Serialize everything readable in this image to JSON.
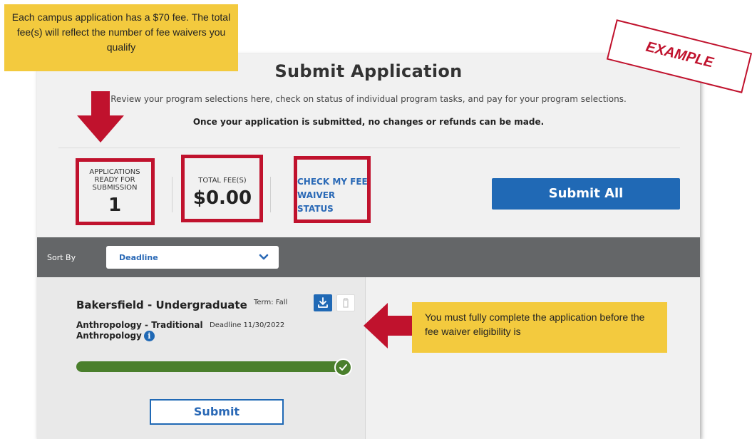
{
  "page": {
    "title": "Submit Application",
    "subtitle": "Review your program selections here, check on status of individual program tasks, and pay for your program selections.",
    "notice": "Once your application is submitted, no changes or refunds can be made."
  },
  "stats": {
    "applications_label": "APPLICATIONS READY FOR SUBMISSION",
    "applications_count": "1",
    "total_fee_label": "TOTAL FEE(S)",
    "total_fee_value": "$0.00",
    "fee_waiver_link": "CHECK MY FEE WAIVER STATUS"
  },
  "actions": {
    "submit_all_label": "Submit All"
  },
  "sort": {
    "label": "Sort By",
    "selected": "Deadline"
  },
  "application": {
    "campus": "Bakersfield - Undergraduate",
    "term": "Term: Fall",
    "program_line1": "Anthropology - Traditional",
    "program_line2": "Anthropology",
    "deadline": "Deadline 11/30/2022",
    "progress_fraction": 1.0,
    "submit_label": "Submit"
  },
  "annotations": {
    "top_callout": "Each campus application has a $70 fee. The total fee(s) will reflect the number of fee waivers you qualify",
    "right_callout": "You must fully complete the application before the fee waiver eligibility is",
    "stamp": "EXAMPLE"
  },
  "colors": {
    "accent_blue": "#2069b5",
    "annotation_red": "#c0122d",
    "callout_yellow": "#f3ca3e",
    "progress_green": "#4a7f2c",
    "sort_bar_gray": "#646668"
  },
  "icons": {
    "download": "download-icon",
    "trash": "trash-icon",
    "info": "info-icon",
    "check": "check-icon",
    "chevron": "chevron-down-icon",
    "arrow_down": "arrow-down-icon",
    "arrow_left": "arrow-left-icon"
  }
}
